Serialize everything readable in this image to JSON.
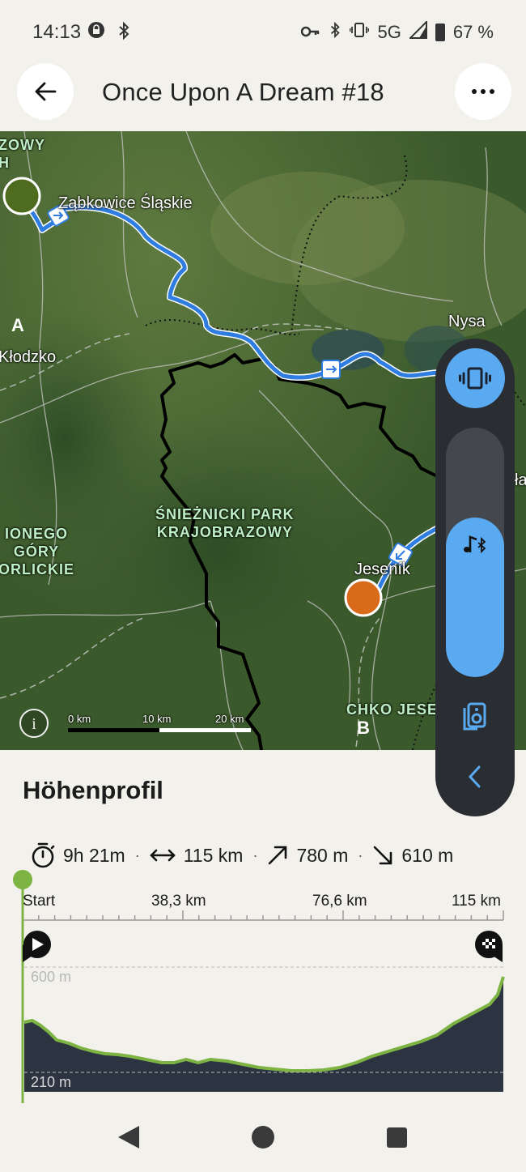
{
  "status_bar": {
    "time": "14:13",
    "network": "5G",
    "battery": "67 %"
  },
  "header": {
    "title": "Once Upon A Dream #18",
    "back_icon": "arrow-left-icon",
    "more_icon": "more-horizontal-icon"
  },
  "map": {
    "labels": {
      "zabkowice": "Ząbkowice Śląskie",
      "nysa": "Nysa",
      "klodzko": "Kłodzko",
      "jesenik": "Jeseník",
      "park": "ŚNIEŻNICKI PARK\nKRAJOBRAZOWY",
      "gory": "IONEGO\nGÓRY\nORLICKIE",
      "chko": "CHKO JESE",
      "zowy": "ZOWY\nH",
      "la": "ła"
    },
    "marker_start": "A",
    "marker_end": "B",
    "scale": {
      "zero": "0 km",
      "mid": "10 km",
      "end": "20 km"
    },
    "route_color": "#2f7de0",
    "border_color": "#000000"
  },
  "side_panel": {
    "vibrate_icon": "vibrate-icon",
    "music_icon": "bluetooth-music-icon",
    "ear_icon": "hearing-icon",
    "collapse_icon": "chevron-left-icon",
    "volume_level": 0.64
  },
  "profile": {
    "title": "Höhenprofil",
    "duration": "9h 21m",
    "distance": "115 km",
    "ascent": "780 m",
    "descent": "610 m",
    "axis": [
      "Start",
      "38,3 km",
      "76,6 km",
      "115 km"
    ],
    "elev_max": "600 m",
    "elev_min": "210 m"
  }
}
